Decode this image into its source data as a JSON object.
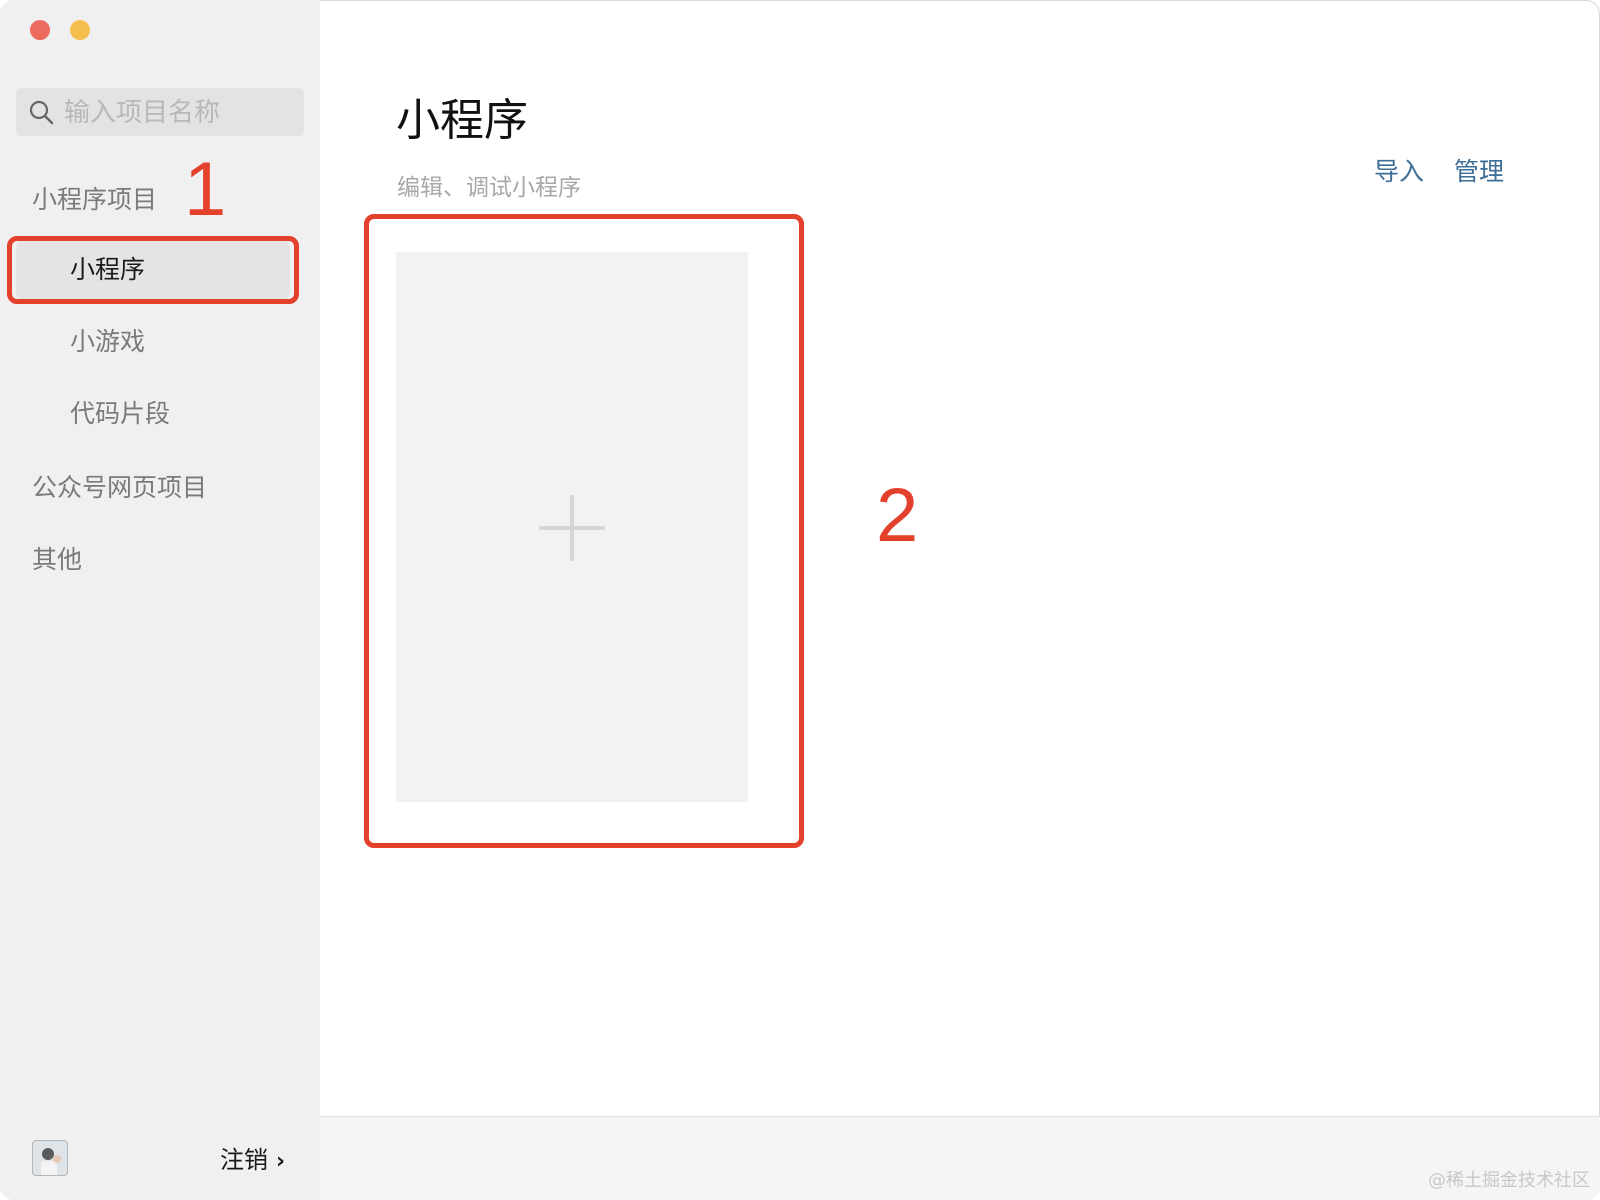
{
  "search": {
    "placeholder": "输入项目名称"
  },
  "sidebar": {
    "section_miniprogram": "小程序项目",
    "items": [
      {
        "label": "小程序",
        "active": true
      },
      {
        "label": "小游戏",
        "active": false
      },
      {
        "label": "代码片段",
        "active": false
      }
    ],
    "section_web": "公众号网页项目",
    "section_other": "其他",
    "logout_label": "注销",
    "logout_chevron": "›"
  },
  "main": {
    "title": "小程序",
    "subtitle": "编辑、调试小程序",
    "actions": {
      "import": "导入",
      "manage": "管理"
    },
    "add_card_icon": "plus-icon"
  },
  "annotations": {
    "one": "1",
    "two": "2",
    "color": "#e4412c"
  },
  "watermark": "@稀土掘金技术社区",
  "colors": {
    "link": "#3e6e96",
    "sidebar_bg": "#f0f0f0",
    "active_item_bg": "#e4e4e4"
  }
}
